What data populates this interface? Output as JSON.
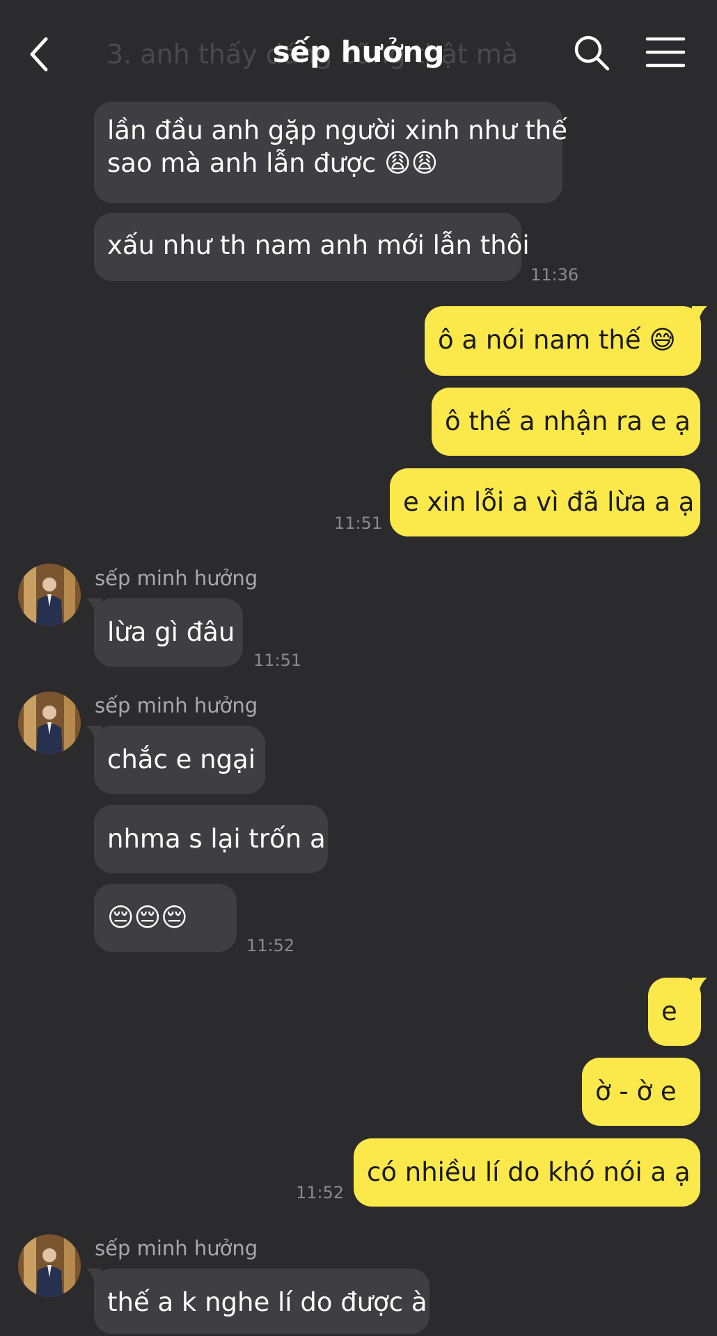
{
  "header": {
    "title": "sếp hưởng",
    "ghost_text": "3. anh thấy dáng cũng thật mà"
  },
  "icons": {
    "back": "chevron-left-icon",
    "search": "search-icon",
    "menu": "hamburger-menu-icon"
  },
  "colors": {
    "background": "#2b2a2d",
    "incoming_bubble": "#3f3e42",
    "outgoing_bubble": "#fbe84a"
  },
  "messages": [
    {
      "dir": "in",
      "text_lines": [
        "lần đầu anh gặp người xinh như thế",
        "sao mà anh lẫn được 😩😩"
      ]
    },
    {
      "dir": "in",
      "text": "xấu như th nam anh mới lẫn thôi",
      "time": "11:36"
    },
    {
      "dir": "out",
      "text": "ô a nói nam thế 😅"
    },
    {
      "dir": "out",
      "text": "ô thế a nhận ra e ạ"
    },
    {
      "dir": "out",
      "text": "e xin lỗi a vì đã lừa a ạ",
      "time": "11:51"
    },
    {
      "dir": "in",
      "sender": "sếp minh hưởng",
      "text": "lừa gì đâu",
      "time": "11:51"
    },
    {
      "dir": "in",
      "sender": "sếp minh hưởng",
      "text": "chắc e ngại"
    },
    {
      "dir": "in",
      "text": "nhma s lại trốn a"
    },
    {
      "dir": "in",
      "text": "😔😔😔",
      "time": "11:52"
    },
    {
      "dir": "out",
      "text": "e"
    },
    {
      "dir": "out",
      "text": "ờ - ờ e"
    },
    {
      "dir": "out",
      "text": "có nhiều lí do khó nói a ạ",
      "time": "11:52"
    },
    {
      "dir": "in",
      "sender": "sếp minh hưởng",
      "text": "thế a k nghe lí do được à"
    }
  ]
}
